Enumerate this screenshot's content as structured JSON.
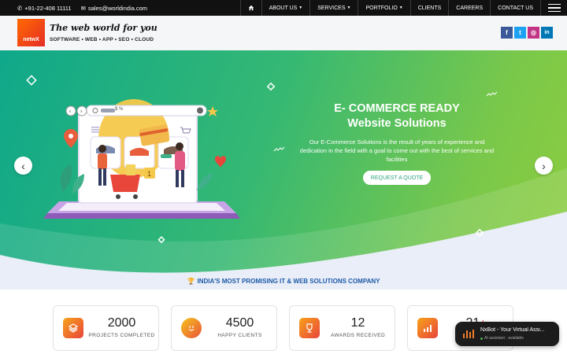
{
  "topbar": {
    "phone": "+91-22-408 11111",
    "email": "sales@worldindia.com",
    "nav": [
      {
        "label": "",
        "icon": "home-icon"
      },
      {
        "label": "ABOUT US",
        "caret": true
      },
      {
        "label": "SERVICES",
        "caret": true
      },
      {
        "label": "PORTFOLIO",
        "caret": true
      },
      {
        "label": "CLIENTS",
        "caret": false
      },
      {
        "label": "CAREERS",
        "caret": false
      },
      {
        "label": "CONTACT US",
        "caret": false
      }
    ]
  },
  "header": {
    "logo_text": "netwX",
    "tagline": "The web world for you",
    "services": "SOFTWARE • WEB • APP • SEO • CLOUD",
    "social": [
      {
        "name": "facebook",
        "glyph": "f",
        "color": "#3b5998"
      },
      {
        "name": "twitter",
        "glyph": "t",
        "color": "#1da1f2"
      },
      {
        "name": "instagram",
        "glyph": "◎",
        "color": "#c13584"
      },
      {
        "name": "linkedin",
        "glyph": "in",
        "color": "#0077b5"
      }
    ]
  },
  "hero": {
    "title_line1": "E- COMMERCE READY",
    "title_line2": "Website Solutions",
    "description": "Our E-Commerce Solutions is the result of years of experience and dedication in the field with a goal to come out with the best of services and facilities",
    "cta": "REQUEST A QUOTE",
    "search_text": "$ %",
    "prev_arrow": "‹",
    "next_arrow": "›"
  },
  "strip": {
    "text": "INDIA'S MOST PROMISING IT & WEB SOLUTIONS COMPANY"
  },
  "stats": [
    {
      "number": "2000",
      "label": "PROJECTS COMPLETED",
      "color": "#f47c20",
      "icon": "layers-icon"
    },
    {
      "number": "4500",
      "label": "HAPPY CLIENTS",
      "color": "#f4a020",
      "icon": "smiley-icon"
    },
    {
      "number": "12",
      "label": "AWARDS RECEIVED",
      "color": "#f47c20",
      "icon": "trophy-icon"
    },
    {
      "number": "21",
      "label": "YE",
      "color": "#f47c20",
      "icon": "growth-icon"
    }
  ],
  "chat": {
    "title": "NxBot - Your Virtual Assi...",
    "status": "AI assistant · available"
  }
}
